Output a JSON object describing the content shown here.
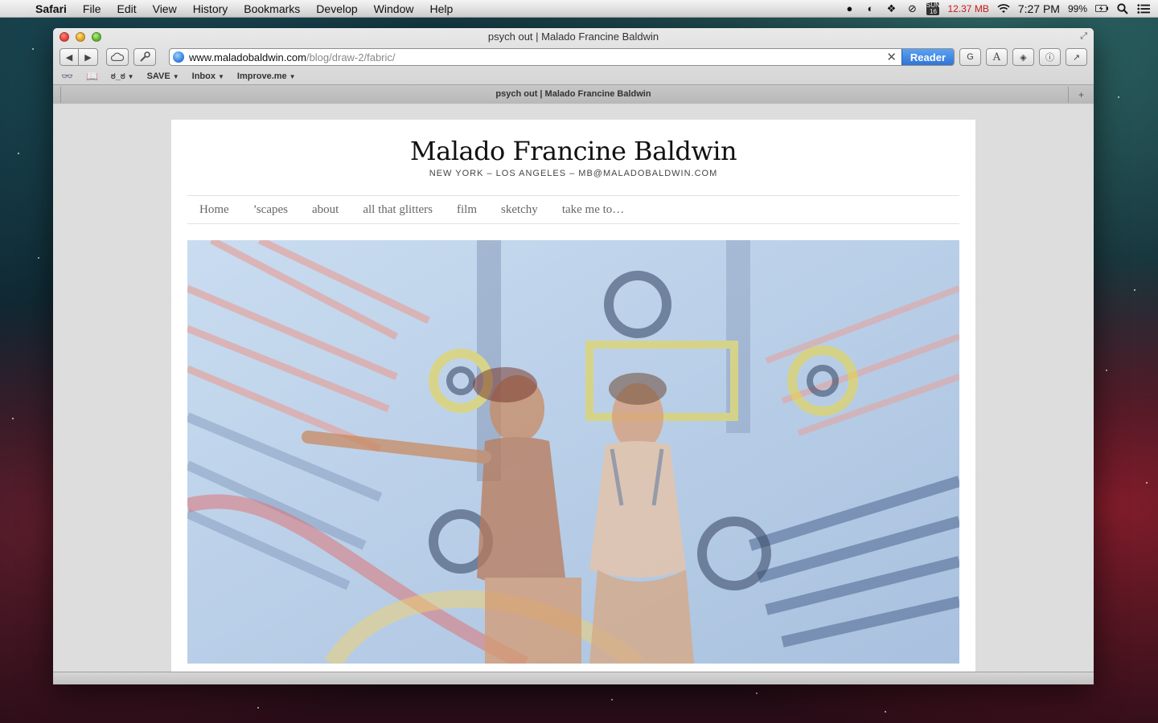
{
  "menubar": {
    "app": "Safari",
    "items": [
      "File",
      "Edit",
      "View",
      "History",
      "Bookmarks",
      "Develop",
      "Window",
      "Help"
    ],
    "memory": "12.37 MB",
    "time": "7:27 PM",
    "battery": "99%",
    "calendar_day": "16",
    "calendar_label": "SUN"
  },
  "window": {
    "title": "psych out | Malado Francine Baldwin",
    "url_host": "www.maladobaldwin.com",
    "url_path": "/blog/draw-2/fabric/",
    "reader_label": "Reader",
    "tab_title": "psych out | Malado Francine Baldwin"
  },
  "bookmarks": {
    "save": "SAVE",
    "inbox": "Inbox",
    "improve": "Improve.me",
    "glyph_menu": "ಠ_ಠ"
  },
  "site": {
    "title": "Malado Francine Baldwin",
    "subtitle": "NEW YORK – LOS ANGELES – MB@MALADOBALDWIN.COM",
    "nav": [
      "Home",
      "’scapes",
      "about",
      "all that glitters",
      "film",
      "sketchy",
      "take me to…"
    ]
  },
  "colors": {
    "reader_blue": "#2f72d4",
    "memory_red": "#d01919"
  },
  "icons": {
    "back": "back-arrow-icon",
    "forward": "forward-arrow-icon",
    "icloud": "icloud-icon",
    "settings": "wrench-icon"
  }
}
